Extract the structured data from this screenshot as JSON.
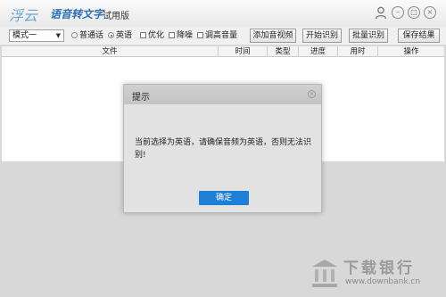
{
  "app": {
    "logo": "浮云",
    "name": "语音转文字",
    "edition": "试用版"
  },
  "window_controls": {
    "user_icon": "user-icon",
    "min_icon": "minimize-icon",
    "max_icon": "maximize-icon",
    "close_icon": "close-icon"
  },
  "toolbar": {
    "mode_select": "模式一",
    "lang_mandarin": "普通话",
    "lang_english": "英语",
    "selected_language": "英语",
    "optimize": "优化",
    "denoise": "降噪",
    "boost_volume": "调高音量",
    "add_button": "添加音视频",
    "start_button": "开始识别",
    "batch_button": "批量识别",
    "save_button": "保存结果"
  },
  "table": {
    "columns": [
      "文件",
      "时间",
      "类型",
      "进度",
      "用时",
      "操作"
    ],
    "rows": []
  },
  "dialog": {
    "title": "提示",
    "message": "当前选择为英语，请确保音频为英语，否则无法识别!",
    "ok_button": "确定"
  },
  "watermark": {
    "title": "下载银行",
    "url": "www.downbank.cn"
  },
  "colors": {
    "accent": "#1e7fd6",
    "logo": "#6aa6d9",
    "app_name": "#2c6fb0"
  }
}
